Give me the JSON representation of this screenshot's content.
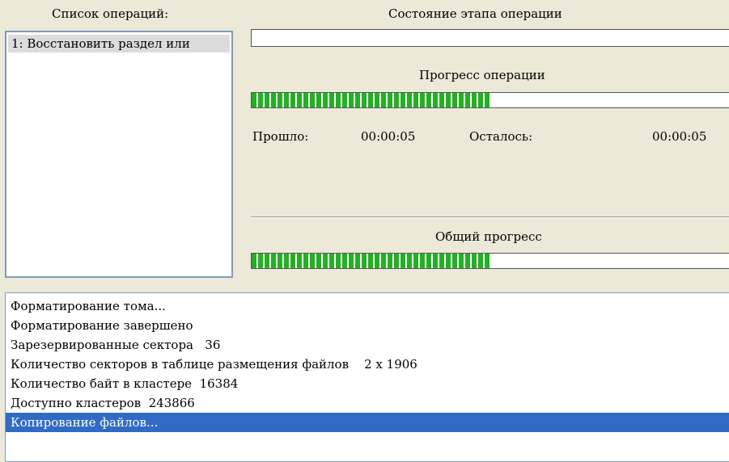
{
  "ops_header": "Список операций:",
  "ops_list": [
    {
      "label": "1: Восстановить раздел или"
    }
  ],
  "stage_header": "Состояние этапа операции",
  "op_progress_header": "Прогресс операции",
  "op_progress": 0.49,
  "elapsed_label": "Прошло:",
  "elapsed_value": "00:00:05",
  "remaining_label": "Осталось:",
  "remaining_value": "00:00:05",
  "total_progress_header": "Общий прогресс",
  "total_progress": 0.49,
  "log": [
    "Форматирование тома...",
    "Форматирование завершено",
    "Зарезервированные сектора   36",
    "Количество секторов в таблице размещения файлов    2 x 1906",
    "Количество байт в кластере  16384",
    "Доступно кластеров  243866",
    "Копирование файлов..."
  ],
  "colors": {
    "progress": "#22b122",
    "selection": "#316ac5"
  }
}
